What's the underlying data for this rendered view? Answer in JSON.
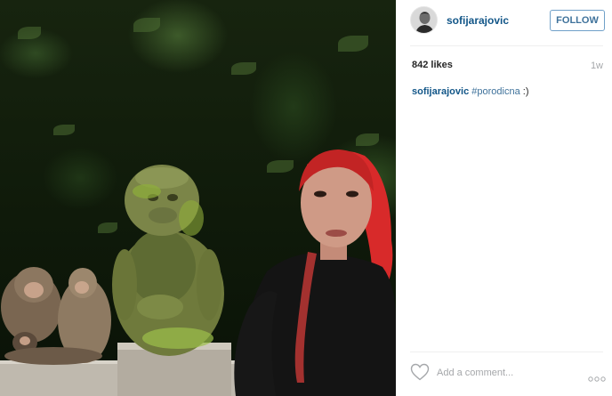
{
  "post": {
    "username": "sofijarajovic",
    "follow_label": "FOLLOW",
    "likes": "842 likes",
    "time": "1w",
    "caption": {
      "username": "sofijarajovic",
      "hashtag": "#porodicna",
      "rest": " :)"
    },
    "comment_placeholder": "Add a comment...",
    "icons": {
      "like": "heart-icon",
      "more": "more-options-icon"
    },
    "colors": {
      "username": "#125688",
      "follow": "#3f729b",
      "hashtag": "#3f729b",
      "muted": "#a5a7aa"
    }
  }
}
